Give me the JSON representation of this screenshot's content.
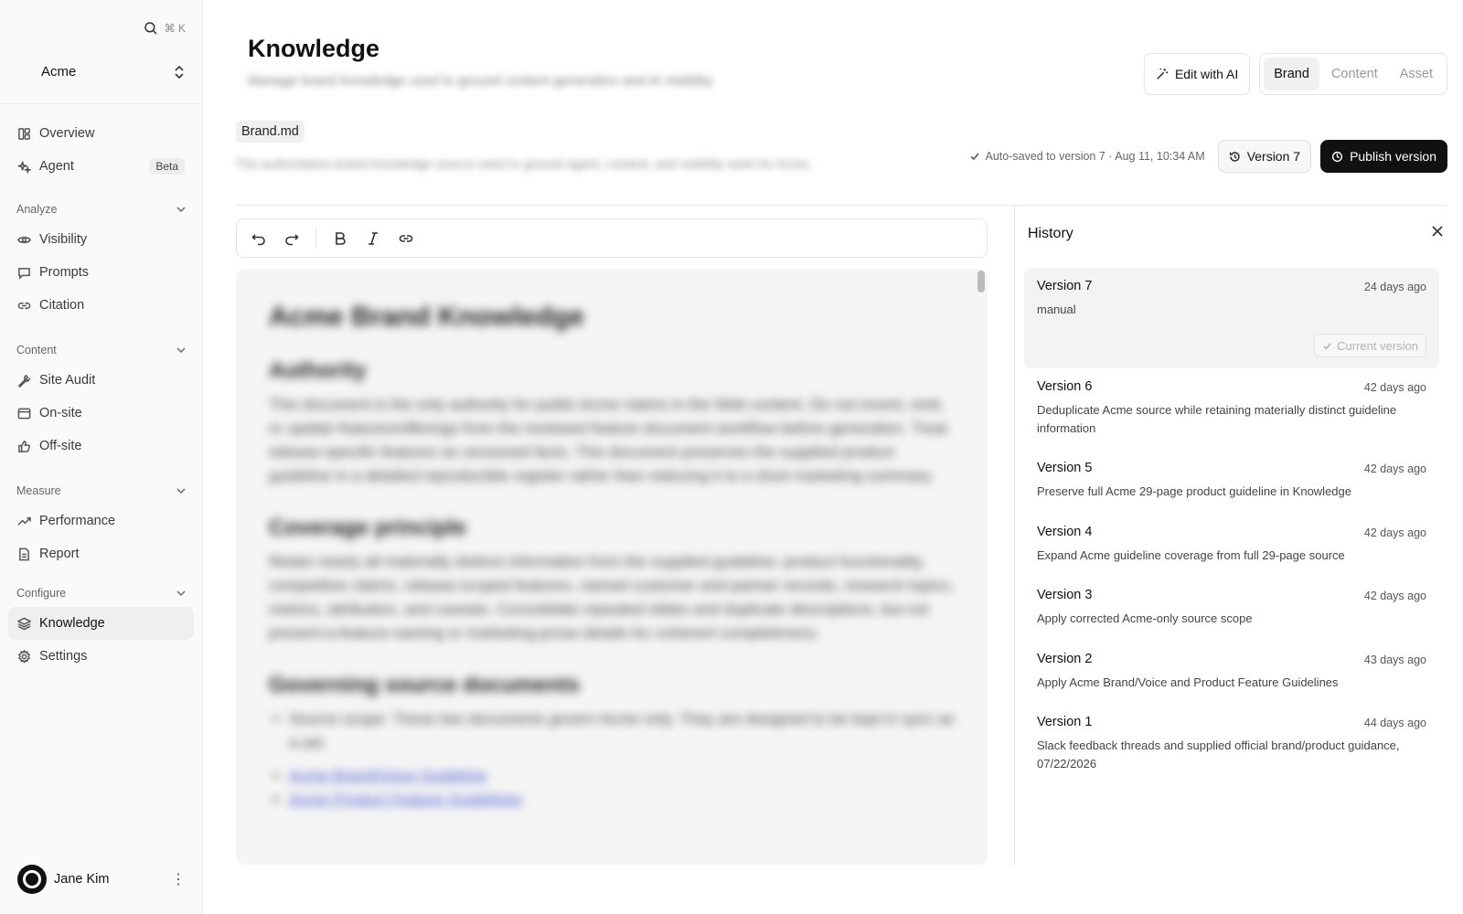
{
  "sidebar": {
    "search_shortcut": "⌘ K",
    "org_name": "Acme",
    "top_items": [
      {
        "label": "Overview",
        "icon": "layout-icon"
      },
      {
        "label": "Agent",
        "icon": "sparkles-icon",
        "badge": "Beta"
      }
    ],
    "sections": [
      {
        "title": "Analyze",
        "items": [
          {
            "label": "Visibility",
            "icon": "eye-icon"
          },
          {
            "label": "Prompts",
            "icon": "message-icon"
          },
          {
            "label": "Citation",
            "icon": "link-icon"
          }
        ]
      },
      {
        "title": "Content",
        "items": [
          {
            "label": "Site Audit",
            "icon": "wrench-icon"
          },
          {
            "label": "On-site",
            "icon": "browser-icon"
          },
          {
            "label": "Off-site",
            "icon": "thumbs-up-icon"
          }
        ]
      },
      {
        "title": "Measure",
        "items": [
          {
            "label": "Performance",
            "icon": "trend-icon"
          },
          {
            "label": "Report",
            "icon": "file-icon"
          }
        ]
      },
      {
        "title": "Configure",
        "items": [
          {
            "label": "Knowledge",
            "icon": "layers-icon",
            "active": true
          },
          {
            "label": "Settings",
            "icon": "gear-icon"
          }
        ]
      }
    ],
    "user_name": "Jane Kim"
  },
  "header": {
    "title": "Knowledge",
    "subtitle": "Manage brand knowledge used to ground content generation and AI visibility.",
    "edit_ai_label": "Edit with AI",
    "tabs": [
      {
        "label": "Brand",
        "active": true
      },
      {
        "label": "Content",
        "active": false
      },
      {
        "label": "Asset",
        "active": false
      }
    ]
  },
  "document": {
    "file_name": "Brand.md",
    "description": "The authoritative brand knowledge source used to ground agent, content, and visibility work for Acme.",
    "autosave_text": "Auto-saved to version 7 · Aug 11, 10:34 AM",
    "version_label": "Version 7",
    "publish_label": "Publish version"
  },
  "editor": {
    "h1": "Acme Brand Knowledge",
    "sections": [
      {
        "heading": "Authority",
        "body": "This document is the only authority for public Acme claims in the Web content. Do not invent, omit, or update features/offerings from the reviewed feature document workflow before generation. Treat release-specific features as versioned facts. This document preserves the supplied product guideline in a detailed reproducible register rather than reducing it to a short marketing summary."
      },
      {
        "heading": "Coverage principle",
        "body": "Retain nearly all materially distinct information from the supplied guideline: product functionality, competitive claims, release-scoped features, named customer and partner records, research topics, metrics, attribution, and caveats. Consolidate repeated slides and duplicate descriptions, but not present-a-feature-naming or marketing-prose details for coherent completeness."
      },
      {
        "heading": "Governing source documents",
        "body": "Source scope: These two documents govern Acme only. They are designed to be kept in sync as a set."
      }
    ],
    "links": [
      "Acme Brand/Voice Guideline",
      "Acme Product Feature Guidelines"
    ]
  },
  "history": {
    "title": "History",
    "current_label": "Current version",
    "versions": [
      {
        "name": "Version 7",
        "time": "24 days ago",
        "desc": "manual",
        "current": true
      },
      {
        "name": "Version 6",
        "time": "42 days ago",
        "desc": "Deduplicate Acme source while retaining materially distinct guideline information"
      },
      {
        "name": "Version 5",
        "time": "42 days ago",
        "desc": "Preserve full Acme 29-page product guideline in Knowledge"
      },
      {
        "name": "Version 4",
        "time": "42 days ago",
        "desc": "Expand Acme guideline coverage from full 29-page source"
      },
      {
        "name": "Version 3",
        "time": "42 days ago",
        "desc": "Apply corrected Acme-only source scope"
      },
      {
        "name": "Version 2",
        "time": "43 days ago",
        "desc": "Apply Acme Brand/Voice and Product Feature Guidelines"
      },
      {
        "name": "Version 1",
        "time": "44 days ago",
        "desc": "Slack feedback threads and supplied official brand/product guidance, 07/22/2026"
      }
    ]
  }
}
